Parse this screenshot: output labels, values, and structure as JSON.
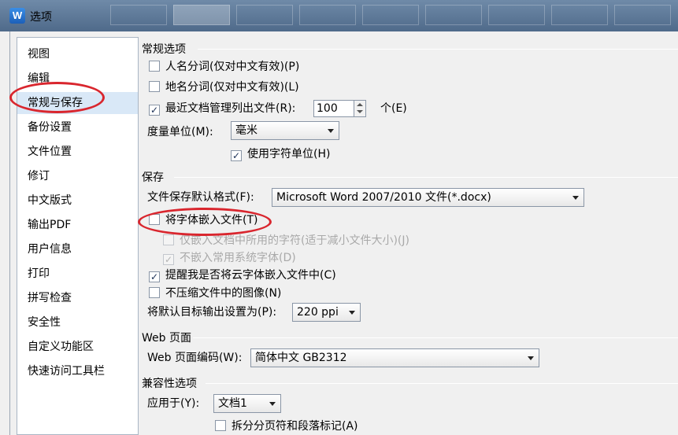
{
  "window": {
    "title": "选项",
    "icon": "wps-writer-icon",
    "background_tabs_count": 9
  },
  "nav": {
    "items": [
      {
        "label": "视图"
      },
      {
        "label": "编辑"
      },
      {
        "label": "常规与保存",
        "selected": true
      },
      {
        "label": "备份设置"
      },
      {
        "label": "文件位置"
      },
      {
        "label": "修订"
      },
      {
        "label": "中文版式"
      },
      {
        "label": "输出PDF"
      },
      {
        "label": "用户信息"
      },
      {
        "label": "打印"
      },
      {
        "label": "拼写检查"
      },
      {
        "label": "安全性"
      },
      {
        "label": "自定义功能区"
      },
      {
        "label": "快速访问工具栏"
      }
    ]
  },
  "general": {
    "title": "常规选项",
    "person_name_seg": {
      "label": "人名分词(仅对中文有效)(P)",
      "checked": false
    },
    "place_name_seg": {
      "label": "地名分词(仅对中文有效)(L)",
      "checked": false
    },
    "recent_docs": {
      "label": "最近文档管理列出文件(R):",
      "checked": true,
      "value": "100",
      "unit": "个(E)"
    },
    "measure_unit": {
      "label": "度量单位(M):",
      "value": "毫米"
    },
    "char_unit": {
      "label": "使用字符单位(H)",
      "checked": true
    }
  },
  "save": {
    "title": "保存",
    "default_format": {
      "label": "文件保存默认格式(F):",
      "value": "Microsoft Word 2007/2010 文件(*.docx)"
    },
    "embed_fonts": {
      "label": "将字体嵌入文件(T)",
      "checked": false
    },
    "embed_used_only": {
      "label": "仅嵌入文档中所用的字符(适于减小文件大小)(J)",
      "checked": false,
      "disabled": true
    },
    "no_common_fonts": {
      "label": "不嵌入常用系统字体(D)",
      "checked": true,
      "disabled": true
    },
    "remind_cloud_fonts": {
      "label": "提醒我是否将云字体嵌入文件中(C)",
      "checked": true
    },
    "no_compress_images": {
      "label": "不压缩文件中的图像(N)",
      "checked": false
    },
    "default_output": {
      "label": "将默认目标输出设置为(P):",
      "value": "220 ppi"
    }
  },
  "web": {
    "title": "Web 页面",
    "encoding": {
      "label": "Web 页面编码(W):",
      "value": "简体中文 GB2312"
    }
  },
  "compat": {
    "title": "兼容性选项",
    "apply_to": {
      "label": "应用于(Y):",
      "value": "文档1"
    },
    "split_page_breaks": {
      "label": "拆分分页符和段落标记(A)",
      "checked": false
    }
  },
  "annotations": {
    "color": "#d9262e"
  },
  "colors": {
    "nav_selected_bg": "#d9e8f7",
    "titlebar": "#5b7696"
  }
}
